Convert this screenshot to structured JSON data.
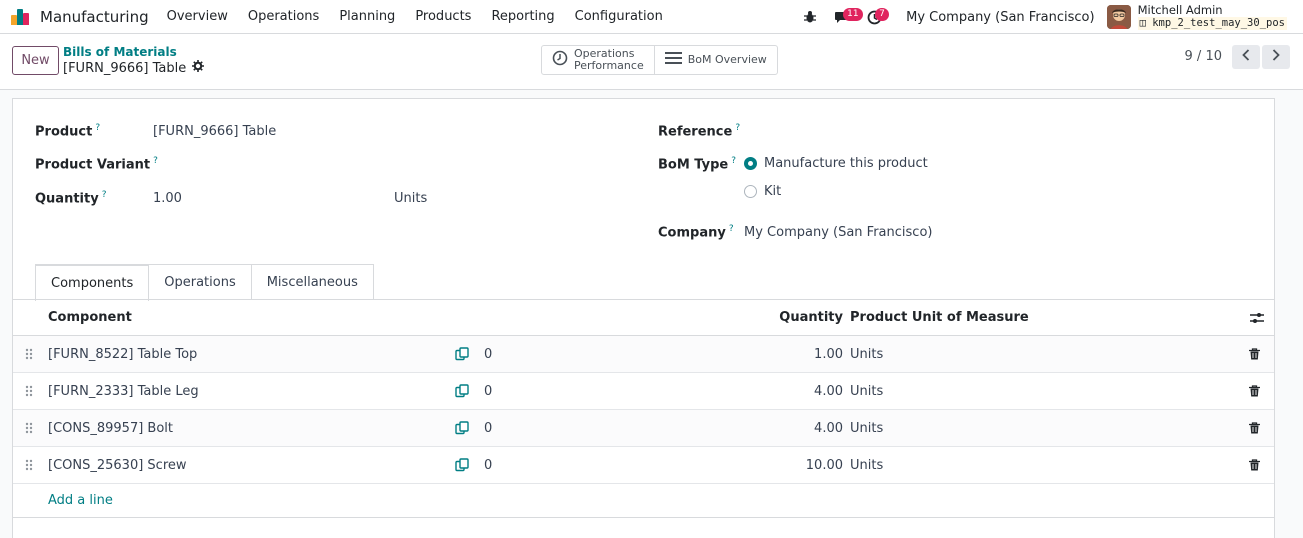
{
  "navbar": {
    "app_name": "Manufacturing",
    "menu": [
      "Overview",
      "Operations",
      "Planning",
      "Products",
      "Reporting",
      "Configuration"
    ],
    "messages_count": "11",
    "activities_count": "7",
    "company": "My Company (San Francisco)",
    "user_name": "Mitchell Admin",
    "db_name": "kmp_2_test_may_30_pos"
  },
  "control": {
    "new_label": "New",
    "breadcrumb": "Bills of Materials",
    "record_title": "[FURN_9666] Table",
    "smart_operations_line1": "Operations",
    "smart_operations_line2": "Performance",
    "smart_bom_overview": "BoM Overview",
    "pager": "9 / 10"
  },
  "form": {
    "product_label": "Product",
    "product_value": "[FURN_9666] Table",
    "variant_label": "Product Variant",
    "quantity_label": "Quantity",
    "quantity_value": "1.00",
    "quantity_uom": "Units",
    "reference_label": "Reference",
    "bom_type_label": "BoM Type",
    "bom_type_options": [
      "Manufacture this product",
      "Kit"
    ],
    "bom_type_selected": "Manufacture this product",
    "company_label": "Company",
    "company_value": "My Company (San Francisco)",
    "help_mark": "?"
  },
  "tabs": [
    "Components",
    "Operations",
    "Miscellaneous"
  ],
  "active_tab": "Components",
  "components_table": {
    "headers": [
      "Component",
      "Quantity",
      "Product Unit of Measure"
    ],
    "rows": [
      {
        "component": "[FURN_8522] Table Top",
        "copies": "0",
        "quantity": "1.00",
        "uom": "Units"
      },
      {
        "component": "[FURN_2333] Table Leg",
        "copies": "0",
        "quantity": "4.00",
        "uom": "Units"
      },
      {
        "component": "[CONS_89957] Bolt",
        "copies": "0",
        "quantity": "4.00",
        "uom": "Units"
      },
      {
        "component": "[CONS_25630] Screw",
        "copies": "0",
        "quantity": "10.00",
        "uom": "Units"
      }
    ],
    "add_line": "Add a line"
  },
  "colors": {
    "accent": "#017e84",
    "brand": "#714b67",
    "badge": "#e0245e"
  },
  "icons": [
    "manufacturing-app-icon",
    "bug-icon",
    "chat-icon",
    "clock-icon",
    "gear-icon",
    "list-icon",
    "chevron-left-icon",
    "chevron-right-icon",
    "drag-handle-icon",
    "copy-icon",
    "trash-icon",
    "sliders-icon"
  ]
}
